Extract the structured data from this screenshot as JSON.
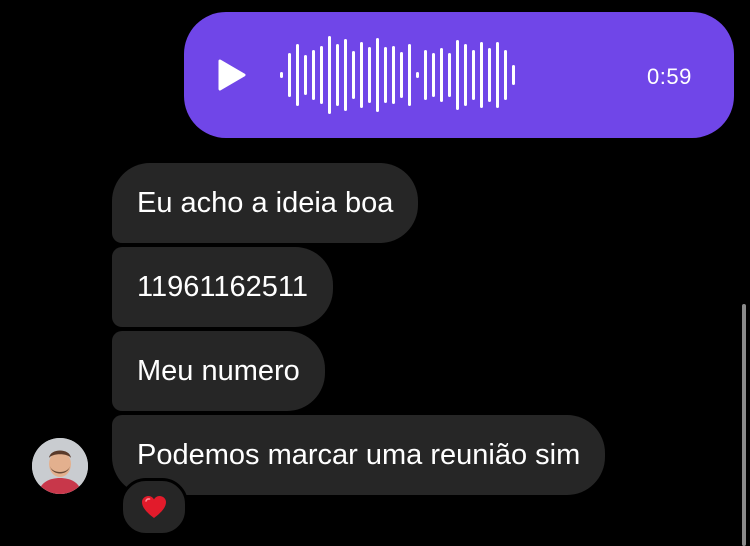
{
  "voice_message": {
    "duration": "0:59",
    "icon": "play-icon",
    "bar_heights": [
      0.08,
      0.55,
      0.78,
      0.5,
      0.62,
      0.72,
      0.98,
      0.78,
      0.9,
      0.6,
      0.82,
      0.7,
      0.92,
      0.7,
      0.72,
      0.58,
      0.78,
      0.08,
      0.62,
      0.55,
      0.68,
      0.55,
      0.88,
      0.78,
      0.62,
      0.82,
      0.68,
      0.82,
      0.62,
      0.25
    ],
    "bubble_color": "#7046e8"
  },
  "messages": [
    {
      "text": "Eu acho a ideia boa"
    },
    {
      "text": "11961162511"
    },
    {
      "text": "Meu numero"
    },
    {
      "text": "Podemos marcar uma reunião sim"
    }
  ],
  "reaction": {
    "emoji": "heart-icon"
  },
  "avatar": {
    "icon": "avatar"
  }
}
